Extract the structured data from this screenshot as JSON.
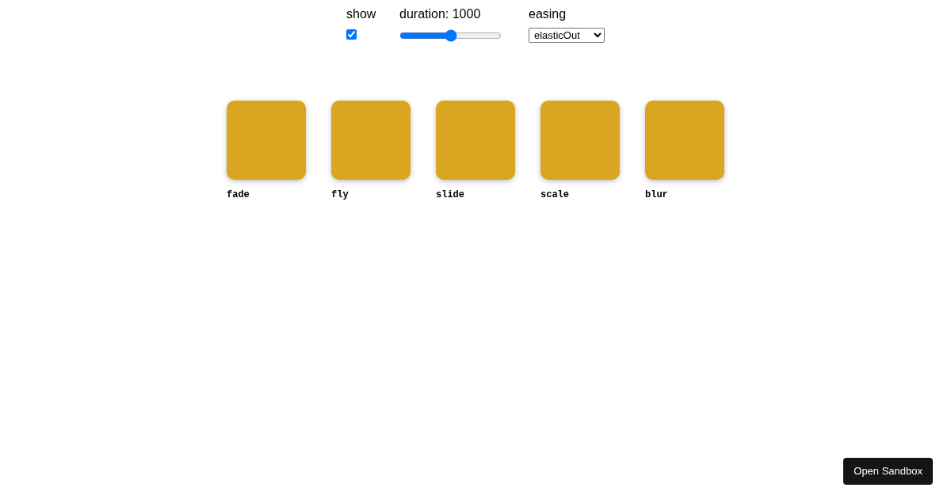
{
  "controls": {
    "show": {
      "label": "show",
      "checked": true
    },
    "duration": {
      "label": "duration: 1000",
      "level": 0.5
    },
    "easing": {
      "label": "easing",
      "value": "elasticOut"
    }
  },
  "boxes": [
    {
      "label": "fade"
    },
    {
      "label": "fly"
    },
    {
      "label": "slide"
    },
    {
      "label": "scale"
    },
    {
      "label": "blur"
    }
  ],
  "open_button": "Open Sandbox"
}
